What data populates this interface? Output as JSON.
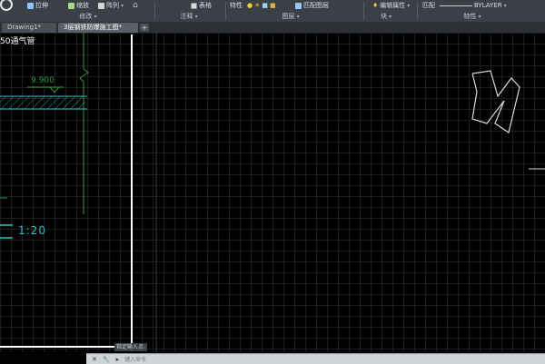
{
  "ribbon": {
    "buttons": {
      "stretch": "拉伸",
      "scale": "缩放",
      "array": "阵列",
      "table": "表格",
      "properties": "特性",
      "match_layer": "匹配图层",
      "edit_attributes": "编辑属性",
      "match": "匹配",
      "bylayer": "BYLAYER"
    },
    "panels": {
      "modify": "修改",
      "annotation": "注释",
      "layers": "图层",
      "block": "块",
      "properties": "特性"
    }
  },
  "tabs": [
    {
      "label": "Drawing1*"
    },
    {
      "label": "3层钢铁防爆施工图*"
    }
  ],
  "drawing": {
    "title_fragment": "50通气管",
    "elevation": "9.900",
    "scale": "1:20"
  },
  "command": {
    "tooltip": "指定输入点:",
    "placeholder": "键入命令"
  },
  "colors": {
    "canvas_bg": "#000000",
    "grid": "#1a1d21",
    "green_dim": "#2e9a3b",
    "cyan_hatch": "#2bc3c3",
    "white_line": "#ffffff"
  }
}
